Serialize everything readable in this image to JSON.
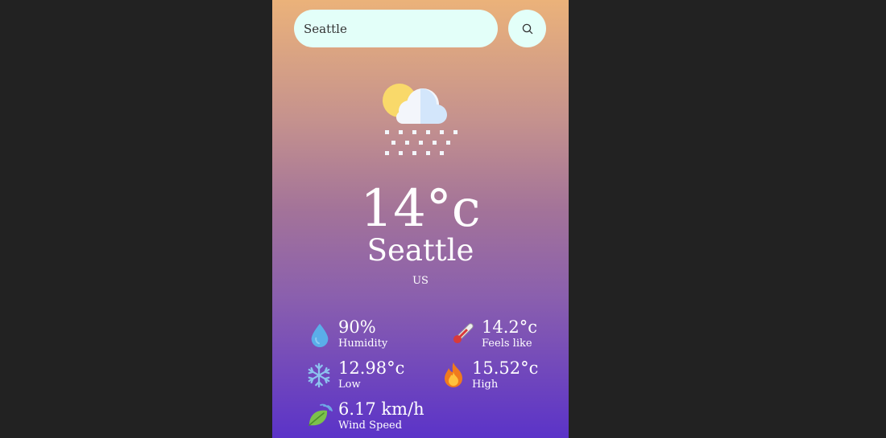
{
  "search": {
    "value": "Seattle",
    "button_icon": "search-icon"
  },
  "weather": {
    "icon": "snow-cloud-sun-icon",
    "temperature": "14°c",
    "city": "Seattle",
    "country": "US"
  },
  "stats": {
    "humidity": {
      "value": "90%",
      "label": "Humidity",
      "icon": "droplet-icon"
    },
    "feels_like": {
      "value": "14.2°c",
      "label": "Feels like",
      "icon": "thermometer-icon"
    },
    "low": {
      "value": "12.98°c",
      "label": "Low",
      "icon": "snowflake-icon"
    },
    "high": {
      "value": "15.52°c",
      "label": "High",
      "icon": "fire-icon"
    },
    "wind": {
      "value": "6.17 km/h",
      "label": "Wind Speed",
      "icon": "wind-leaf-icon"
    }
  },
  "colors": {
    "page_background": "#222222",
    "gradient_top": "#ebb27a",
    "gradient_bottom": "#5b33c8",
    "input_background": "#e3fff9",
    "text": "#ffffff"
  }
}
